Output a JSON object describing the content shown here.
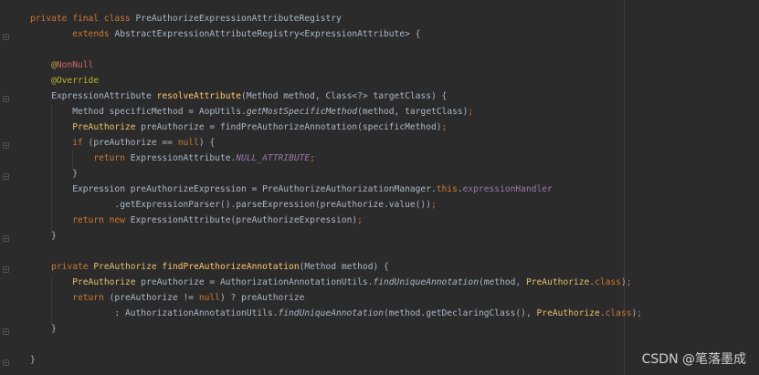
{
  "lines": [
    [
      "private final class PreAuthorizeExpressionAttributeRegistry"
    ],
    [
      "extends AbstractExpressionAttributeRegistry<ExpressionAttribute> {"
    ],
    [
      ""
    ],
    [
      "@NonNull"
    ],
    [
      "@Override"
    ],
    [
      "ExpressionAttribute resolveAttribute(Method method, Class<?> targetClass) {"
    ],
    [
      "Method specificMethod = AopUtils.getMostSpecificMethod(method, targetClass);"
    ],
    [
      "PreAuthorize preAuthorize = findPreAuthorizeAnnotation(specificMethod);"
    ],
    [
      "if (preAuthorize == null) {"
    ],
    [
      "return ExpressionAttribute.NULL_ATTRIBUTE;"
    ],
    [
      "}"
    ],
    [
      "Expression preAuthorizeExpression = PreAuthorizeAuthorizationManager.this.expressionHandler"
    ],
    [
      ".getExpressionParser().parseExpression(preAuthorize.value());"
    ],
    [
      "return new ExpressionAttribute(preAuthorizeExpression);"
    ],
    [
      "}"
    ],
    [
      ""
    ],
    [
      "private PreAuthorize findPreAuthorizeAnnotation(Method method) {"
    ],
    [
      "PreAuthorize preAuthorize = AuthorizationAnnotationUtils.findUniqueAnnotation(method, PreAuthorize.class);"
    ],
    [
      "return (preAuthorize != null) ? preAuthorize"
    ],
    [
      ": AuthorizationAnnotationUtils.findUniqueAnnotation(method.getDeclaringClass(), PreAuthorize.class);"
    ],
    [
      "}"
    ],
    [
      ""
    ],
    [
      "}"
    ]
  ],
  "watermark": "CSDN @笔落墨成"
}
